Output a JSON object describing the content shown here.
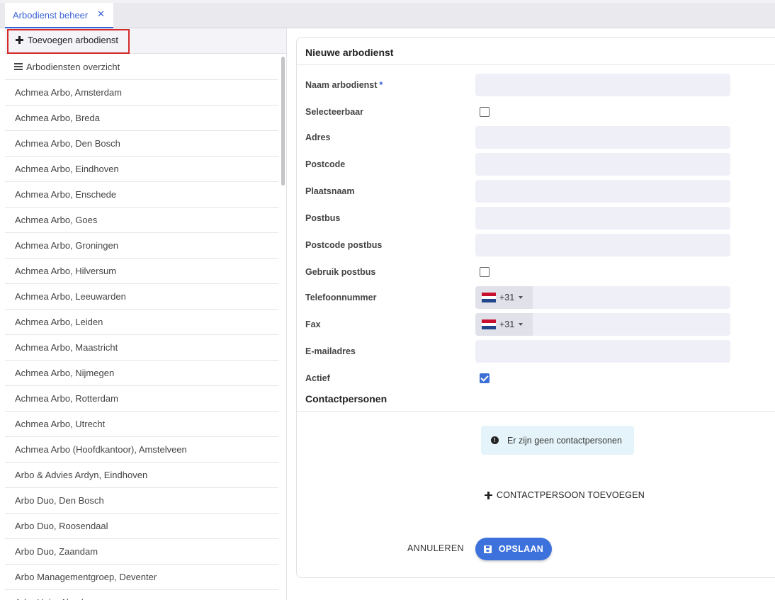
{
  "tab": {
    "label": "Arbodienst beheer",
    "close_glyph": "✕"
  },
  "sidebar": {
    "add_label": "Toevoegen arbodienst",
    "overview_label": "Arbodiensten overzicht",
    "items": [
      "Achmea Arbo, Amsterdam",
      "Achmea Arbo, Breda",
      "Achmea Arbo, Den Bosch",
      "Achmea Arbo, Eindhoven",
      "Achmea Arbo, Enschede",
      "Achmea Arbo, Goes",
      "Achmea Arbo, Groningen",
      "Achmea Arbo, Hilversum",
      "Achmea Arbo, Leeuwarden",
      "Achmea Arbo, Leiden",
      "Achmea Arbo, Maastricht",
      "Achmea Arbo, Nijmegen",
      "Achmea Arbo, Rotterdam",
      "Achmea Arbo, Utrecht",
      "Achmea Arbo (Hoofdkantoor), Amstelveen",
      "Arbo & Advies Ardyn, Eindhoven",
      "Arbo Duo, Den Bosch",
      "Arbo Duo, Roosendaal",
      "Arbo Duo, Zaandam",
      "Arbo Managementgroep, Deventer",
      "Arbo Unie, Almelo"
    ]
  },
  "form": {
    "title": "Nieuwe arbodienst",
    "required_marker": "*",
    "labels": {
      "naam": "Naam arbodienst",
      "selecteerbaar": "Selecteerbaar",
      "adres": "Adres",
      "postcode": "Postcode",
      "plaatsnaam": "Plaatsnaam",
      "postbus": "Postbus",
      "postcode_postbus": "Postcode postbus",
      "gebruik_postbus": "Gebruik postbus",
      "telefoon": "Telefoonnummer",
      "fax": "Fax",
      "email": "E-mailadres",
      "actief": "Actief"
    },
    "values": {
      "naam": "",
      "adres": "",
      "postcode": "",
      "plaatsnaam": "",
      "postbus": "",
      "postcode_postbus": "",
      "email": "",
      "telefoon": "",
      "fax": ""
    },
    "checks": {
      "selecteerbaar": false,
      "gebruik_postbus": false,
      "actief": true
    },
    "phone_prefix": "+31"
  },
  "contacts": {
    "title": "Contactpersonen",
    "empty_message": "Er zijn geen contactpersonen",
    "add_label": "CONTACTPERSOON TOEVOEGEN"
  },
  "actions": {
    "cancel": "ANNULEREN",
    "save": "OPSLAAN"
  },
  "colors": {
    "accent": "#3b63d6",
    "highlight": "#d42a2a",
    "input_bg": "#efeff8",
    "info_bg": "#e5f4fa"
  }
}
